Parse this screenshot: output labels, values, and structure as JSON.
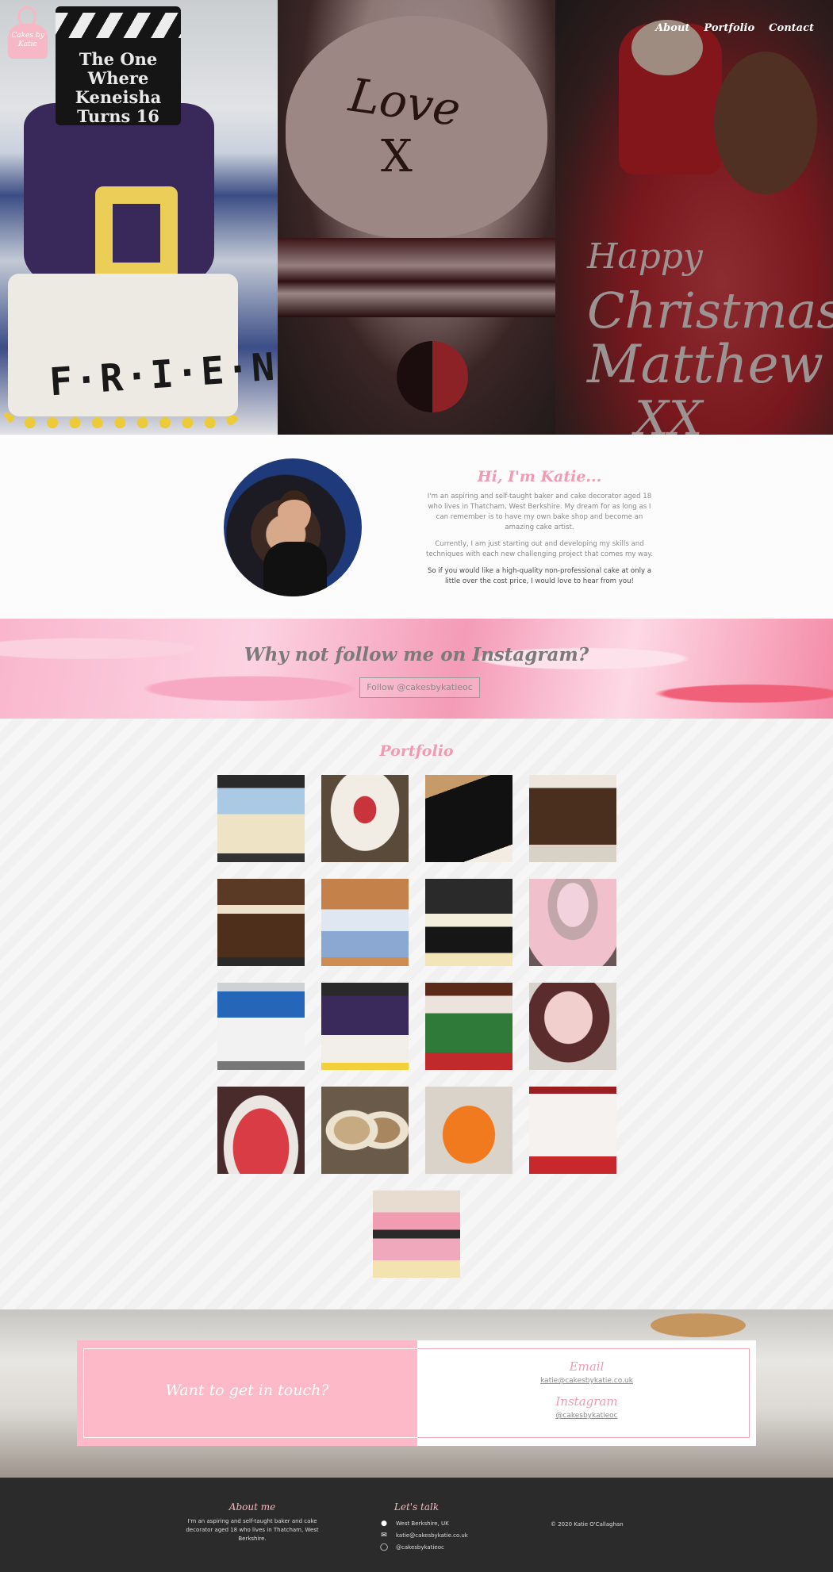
{
  "logo": {
    "text": "Cakes by Katie"
  },
  "nav": {
    "items": [
      "About",
      "Portfolio",
      "Contact"
    ]
  },
  "hero": {
    "slide1_clapper": "The One Where Keneisha Turns 16",
    "slide1_cake_text": "F·R·I·E·N·D·S",
    "slide2_cake_text_1": "Love",
    "slide2_cake_text_2": "X",
    "slide3_cake_text_1": "Happy",
    "slide3_cake_text_2": "Christmas",
    "slide3_cake_text_3": "Matthew",
    "slide3_cake_text_4": "XX"
  },
  "about": {
    "title": "Hi, I'm Katie...",
    "p1": "I'm an aspiring and self-taught baker and cake decorator aged 18 who lives in Thatcham, West Berkshire. My dream for as long as I can remember is to have my own bake shop and become an amazing cake artist.",
    "p2": "Currently, I am just starting out and developing my skills and techniques with each new challenging project that comes my way.",
    "p3": "So if you would like a high-quality non-professional cake at only a little over the cost price, I would love to hear from you!"
  },
  "instagram": {
    "title": "Why not follow me on Instagram?",
    "button": "Follow @cakesbykatieoc"
  },
  "portfolio": {
    "title": "Portfolio",
    "items": [
      "Tiered 18th birthday cake",
      "Red rose birthday cake",
      "Gucci cake",
      "Wooden shed cake",
      "Chocolate drip 18th cake",
      "Blue diamond tiered cake",
      "Guinness pint cake",
      "Pink flower 80th cake",
      "PlayStation controller cake",
      "Friends themed cake",
      "Football pitch cake",
      "Love heart cake",
      "Christmas Matthew cake",
      "Malteser 80 cake",
      "Pumpkin cake",
      "Liverpool FC cake",
      "Pink 13th tiered cake"
    ]
  },
  "contact": {
    "heading": "Want to get in touch?",
    "email_label": "Email",
    "email": "katie@cakesbykatie.co.uk",
    "instagram_label": "Instagram",
    "instagram": "@cakesbykatieoc"
  },
  "footer": {
    "about_title": "About me",
    "about_text": "I'm an aspiring and self-taught baker and cake decorator aged 18 who lives in Thatcham, West Berkshire.",
    "talk_title": "Let's talk",
    "location": "West Berkshire, UK",
    "email": "katie@cakesbykatie.co.uk",
    "instagram": "@cakesbykatieoc",
    "copyright": "© 2020 Katie O'Callaghan"
  },
  "colors": {
    "accent_pink": "#f39ab2",
    "card_pink": "#fdb9c7",
    "footer_bg": "#2b2b2b"
  },
  "icons": {
    "location": "map-pin-icon",
    "email": "envelope-icon",
    "instagram": "instagram-icon"
  }
}
